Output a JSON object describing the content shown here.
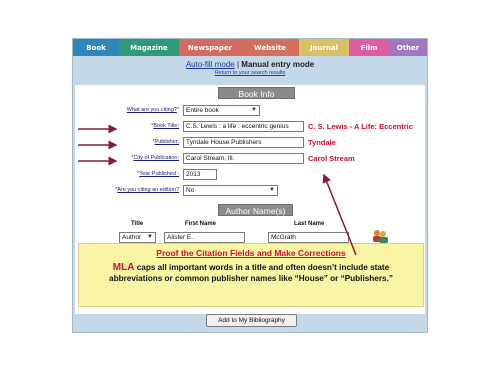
{
  "tabs": [
    {
      "label": "Book",
      "color": "#2e87b8"
    },
    {
      "label": "Magazine",
      "color": "#2f9a78"
    },
    {
      "label": "Newspaper",
      "color": "#d56a63"
    },
    {
      "label": "Website",
      "color": "#d2705c"
    },
    {
      "label": "Journal",
      "color": "#d9c163"
    },
    {
      "label": "Film",
      "color": "#dd5da3"
    },
    {
      "label": "Other",
      "color": "#a078c2"
    }
  ],
  "mode": {
    "autofill": "Auto-fill mode",
    "separator": "|",
    "manual": "Manual entry mode",
    "return_link": "Return to your search results"
  },
  "book_info": {
    "title": "Book Info",
    "citing_label": "What are you citing?",
    "citing_value": "Entire book",
    "book_title_label": "Book Title:",
    "book_title_value": "C.S. Lewis : a life : eccentric genius",
    "publisher_label": "Publisher:",
    "publisher_value": "Tyndale House Publishers",
    "city_label": "City of Publication:",
    "city_value": "Carol Stream, Ill.",
    "year_label": "Year Published :",
    "year_value": "2013",
    "edition_label": "Are you citing an edition?",
    "edition_value": "No",
    "required_mark": "*"
  },
  "annotations": {
    "title_fix": "C. S.  Lewis - A Life: Eccentric",
    "publisher_fix": "Tyndale",
    "city_fix": "Carol Stream"
  },
  "author": {
    "title": "Author Name(s)",
    "col_title": "Title",
    "col_first": "First Name",
    "col_last": "Last Name",
    "title_value": "Author",
    "first_value": "Alister E.",
    "last_value": "McGrath"
  },
  "callout": {
    "heading": "Proof the Citation Fields and Make Corrections",
    "mla": "MLA",
    "body": " caps all important words in a title and often doesn’t include state abbreviations or common publisher names like “House” or “Publishers.”"
  },
  "button": {
    "add_label": "Add to My Bibliography"
  },
  "colors": {
    "frame": "#c5d8e8",
    "note_red": "#c8102e",
    "callout_bg": "#f8f5a4",
    "arrow": "#8b1a3a"
  }
}
